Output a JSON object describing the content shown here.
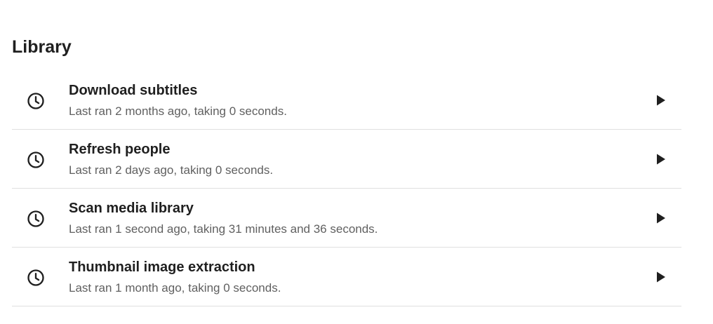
{
  "section": {
    "title": "Library"
  },
  "tasks": [
    {
      "name": "Download subtitles",
      "status": "Last ran 2 months ago, taking 0 seconds.",
      "icon": "clock-icon",
      "action_icon": "play-icon"
    },
    {
      "name": "Refresh people",
      "status": "Last ran 2 days ago, taking 0 seconds.",
      "icon": "clock-icon",
      "action_icon": "play-icon"
    },
    {
      "name": "Scan media library",
      "status": "Last ran 1 second ago, taking 31 minutes and 36 seconds.",
      "icon": "clock-icon",
      "action_icon": "play-icon"
    },
    {
      "name": "Thumbnail image extraction",
      "status": "Last ran 1 month ago, taking 0 seconds.",
      "icon": "clock-icon",
      "action_icon": "play-icon"
    }
  ]
}
